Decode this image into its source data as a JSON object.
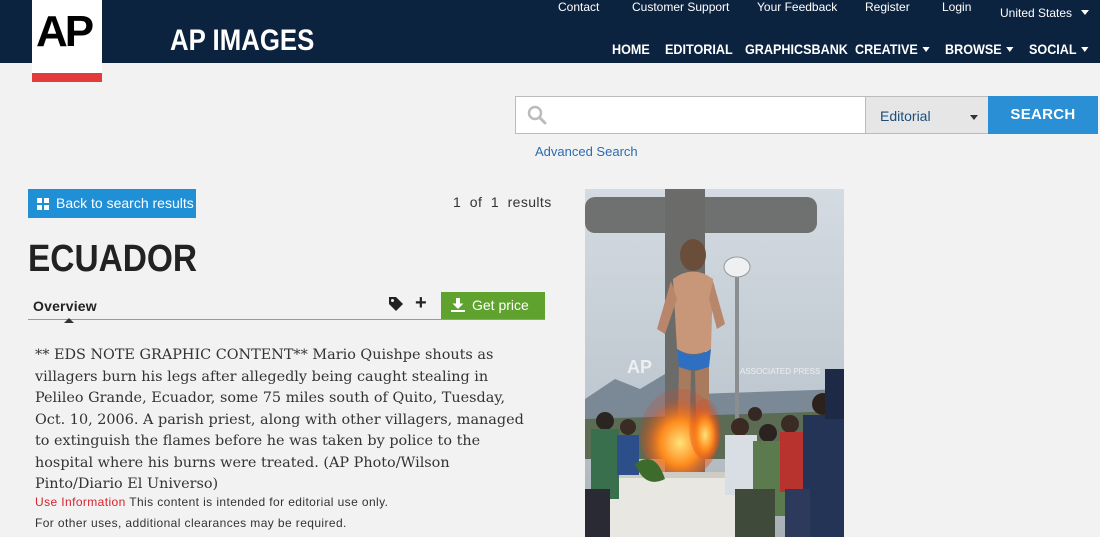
{
  "header": {
    "logo": "AP",
    "brand": "AP IMAGES",
    "util_nav": [
      "Contact",
      "Customer Support",
      "Your Feedback",
      "Register",
      "Login",
      "United States"
    ],
    "main_nav": [
      "HOME",
      "EDITORIAL",
      "GRAPHICSBANK",
      "CREATIVE",
      "BROWSE",
      "SOCIAL"
    ]
  },
  "search": {
    "placeholder": "",
    "value": "",
    "selected_option": "Editorial",
    "button_label": "SEARCH",
    "advanced_label": "Advanced Search"
  },
  "results": {
    "back_label": "Back to search results",
    "count": "1  of  1  results"
  },
  "item": {
    "title": "ECUADOR",
    "tab_overview": "Overview",
    "get_price_label": "Get price",
    "caption": "** EDS NOTE GRAPHIC CONTENT** Mario Quishpe shouts as villagers burn his legs after allegedly being caught stealing in Pelileo Grande, Ecuador, some 75 miles south of Quito, Tuesday, Oct. 10, 2006. A parish priest, along with other villagers, managed to extinguish the flames before he was taken by police to the hospital where his burns were treated. (AP Photo/Wilson Pinto/Diario El Universo)",
    "use_info_label": "Use Information",
    "use_info_text": " This content is intended for editorial use only.",
    "use_info_text2": "For other uses, additional clearances may be required."
  },
  "photo": {
    "watermark_logo": "AP",
    "watermark_text": "ASSOCIATED PRESS"
  },
  "colors": {
    "header_bg": "#0c2340",
    "accent_blue": "#2b8fd6",
    "price_green": "#5fa32e",
    "logo_red": "#e33b3b",
    "use_info_red": "#d9232e"
  }
}
